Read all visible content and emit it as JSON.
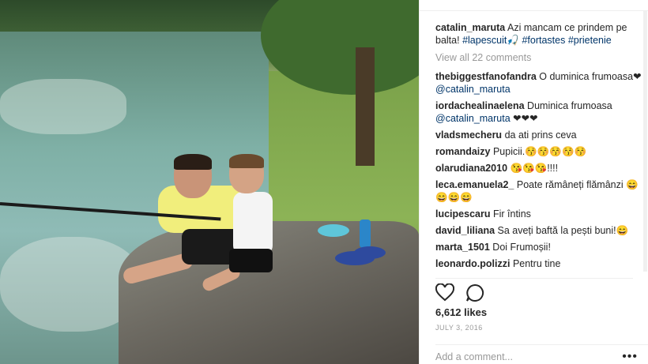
{
  "post": {
    "author": "catalin_maruta",
    "caption_text": "Azi mancam ce prindem pe balta!",
    "caption_tags": [
      "#lapescuit",
      "#fortastes",
      "#prietenie"
    ],
    "caption_emoji": "🎣"
  },
  "view_all": "View all 22 comments",
  "comments": [
    {
      "user": "thebiggestfanofandra",
      "text": "O duminica frumoasa❤",
      "mention": "@catalin_maruta"
    },
    {
      "user": "iordachealinaelena",
      "text": "Duminica frumoasa",
      "mention": "@catalin_maruta",
      "suffix": "❤❤❤"
    },
    {
      "user": "vladsmecheru",
      "text": "da ati prins ceva"
    },
    {
      "user": "romandaizy",
      "text": "Pupicii.😚😚😚😚😚"
    },
    {
      "user": "olarudiana2010",
      "text": "😘😘😘!!!!"
    },
    {
      "user": "leca.emanuela2_",
      "text": "Poate rămâneți flămânzi 😄😄😄😄"
    },
    {
      "user": "lucipescaru",
      "text": "Fir întins"
    },
    {
      "user": "david_liliana",
      "text": "Sa aveți baftă la pești buni!😄"
    },
    {
      "user": "marta_1501",
      "text": "Doi Frumoșii!"
    },
    {
      "user": "leonardo.polizzi",
      "text": "Pentru tine"
    }
  ],
  "actions": {
    "like_icon": "heart-icon",
    "comment_icon": "comment-icon"
  },
  "likes": "6,612 likes",
  "date": "JULY 3, 2016",
  "add_comment": {
    "placeholder": "Add a comment...",
    "more_icon": "more-icon",
    "more_label": "•••"
  }
}
